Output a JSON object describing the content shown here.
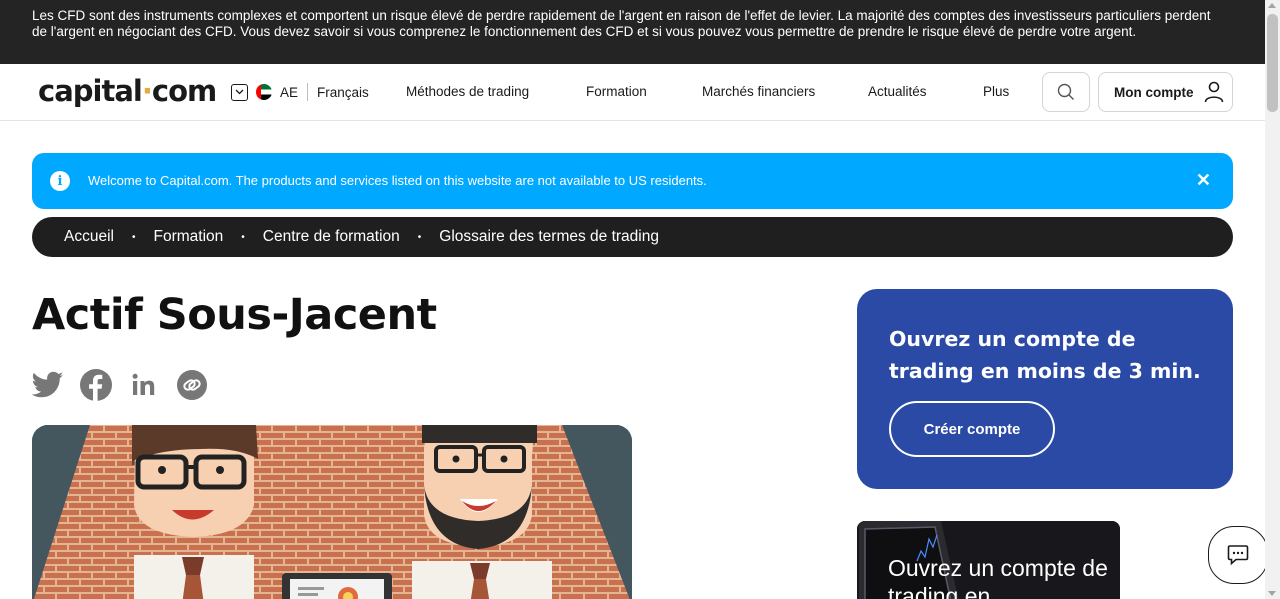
{
  "risk_banner": {
    "text": "Les CFD sont des instruments complexes et comportent un risque élevé de perdre rapidement de l'argent en raison de l'effet de levier. La majorité des comptes des investisseurs particuliers perdent de l'argent en négociant des CFD. Vous devez savoir si vous comprenez le fonctionnement des CFD et si vous pouvez vous permettre de prendre le risque élevé de perdre votre argent."
  },
  "header": {
    "logo_left": "capital",
    "logo_dot": "·",
    "logo_right": "com",
    "region_code": "AE",
    "language": "Français",
    "nav": [
      "Méthodes de trading",
      "Formation",
      "Marchés financiers",
      "Actualités",
      "Plus"
    ],
    "account_label": "Mon compte"
  },
  "alert": {
    "message": "Welcome to Capital.com. The products and services listed on this website are not available to US residents.",
    "close_symbol": "✕",
    "info_symbol": "i"
  },
  "breadcrumb": {
    "items": [
      "Accueil",
      "Formation",
      "Centre de formation",
      "Glossaire des termes de trading"
    ],
    "separator": "•"
  },
  "article": {
    "title": "Actif Sous-Jacent"
  },
  "promo": {
    "title": "Ouvrez un compte de trading en moins de 3 min.",
    "button": "Créer compte"
  },
  "promo2": {
    "text": "Ouvrez un compte de trading en"
  },
  "colors": {
    "risk_bg": "#242424",
    "alert_bg": "#00a8ff",
    "promo_bg": "#2b4aa6",
    "breadcrumb_bg": "#1f1f1f",
    "logo_dot": "#e6a93a"
  }
}
